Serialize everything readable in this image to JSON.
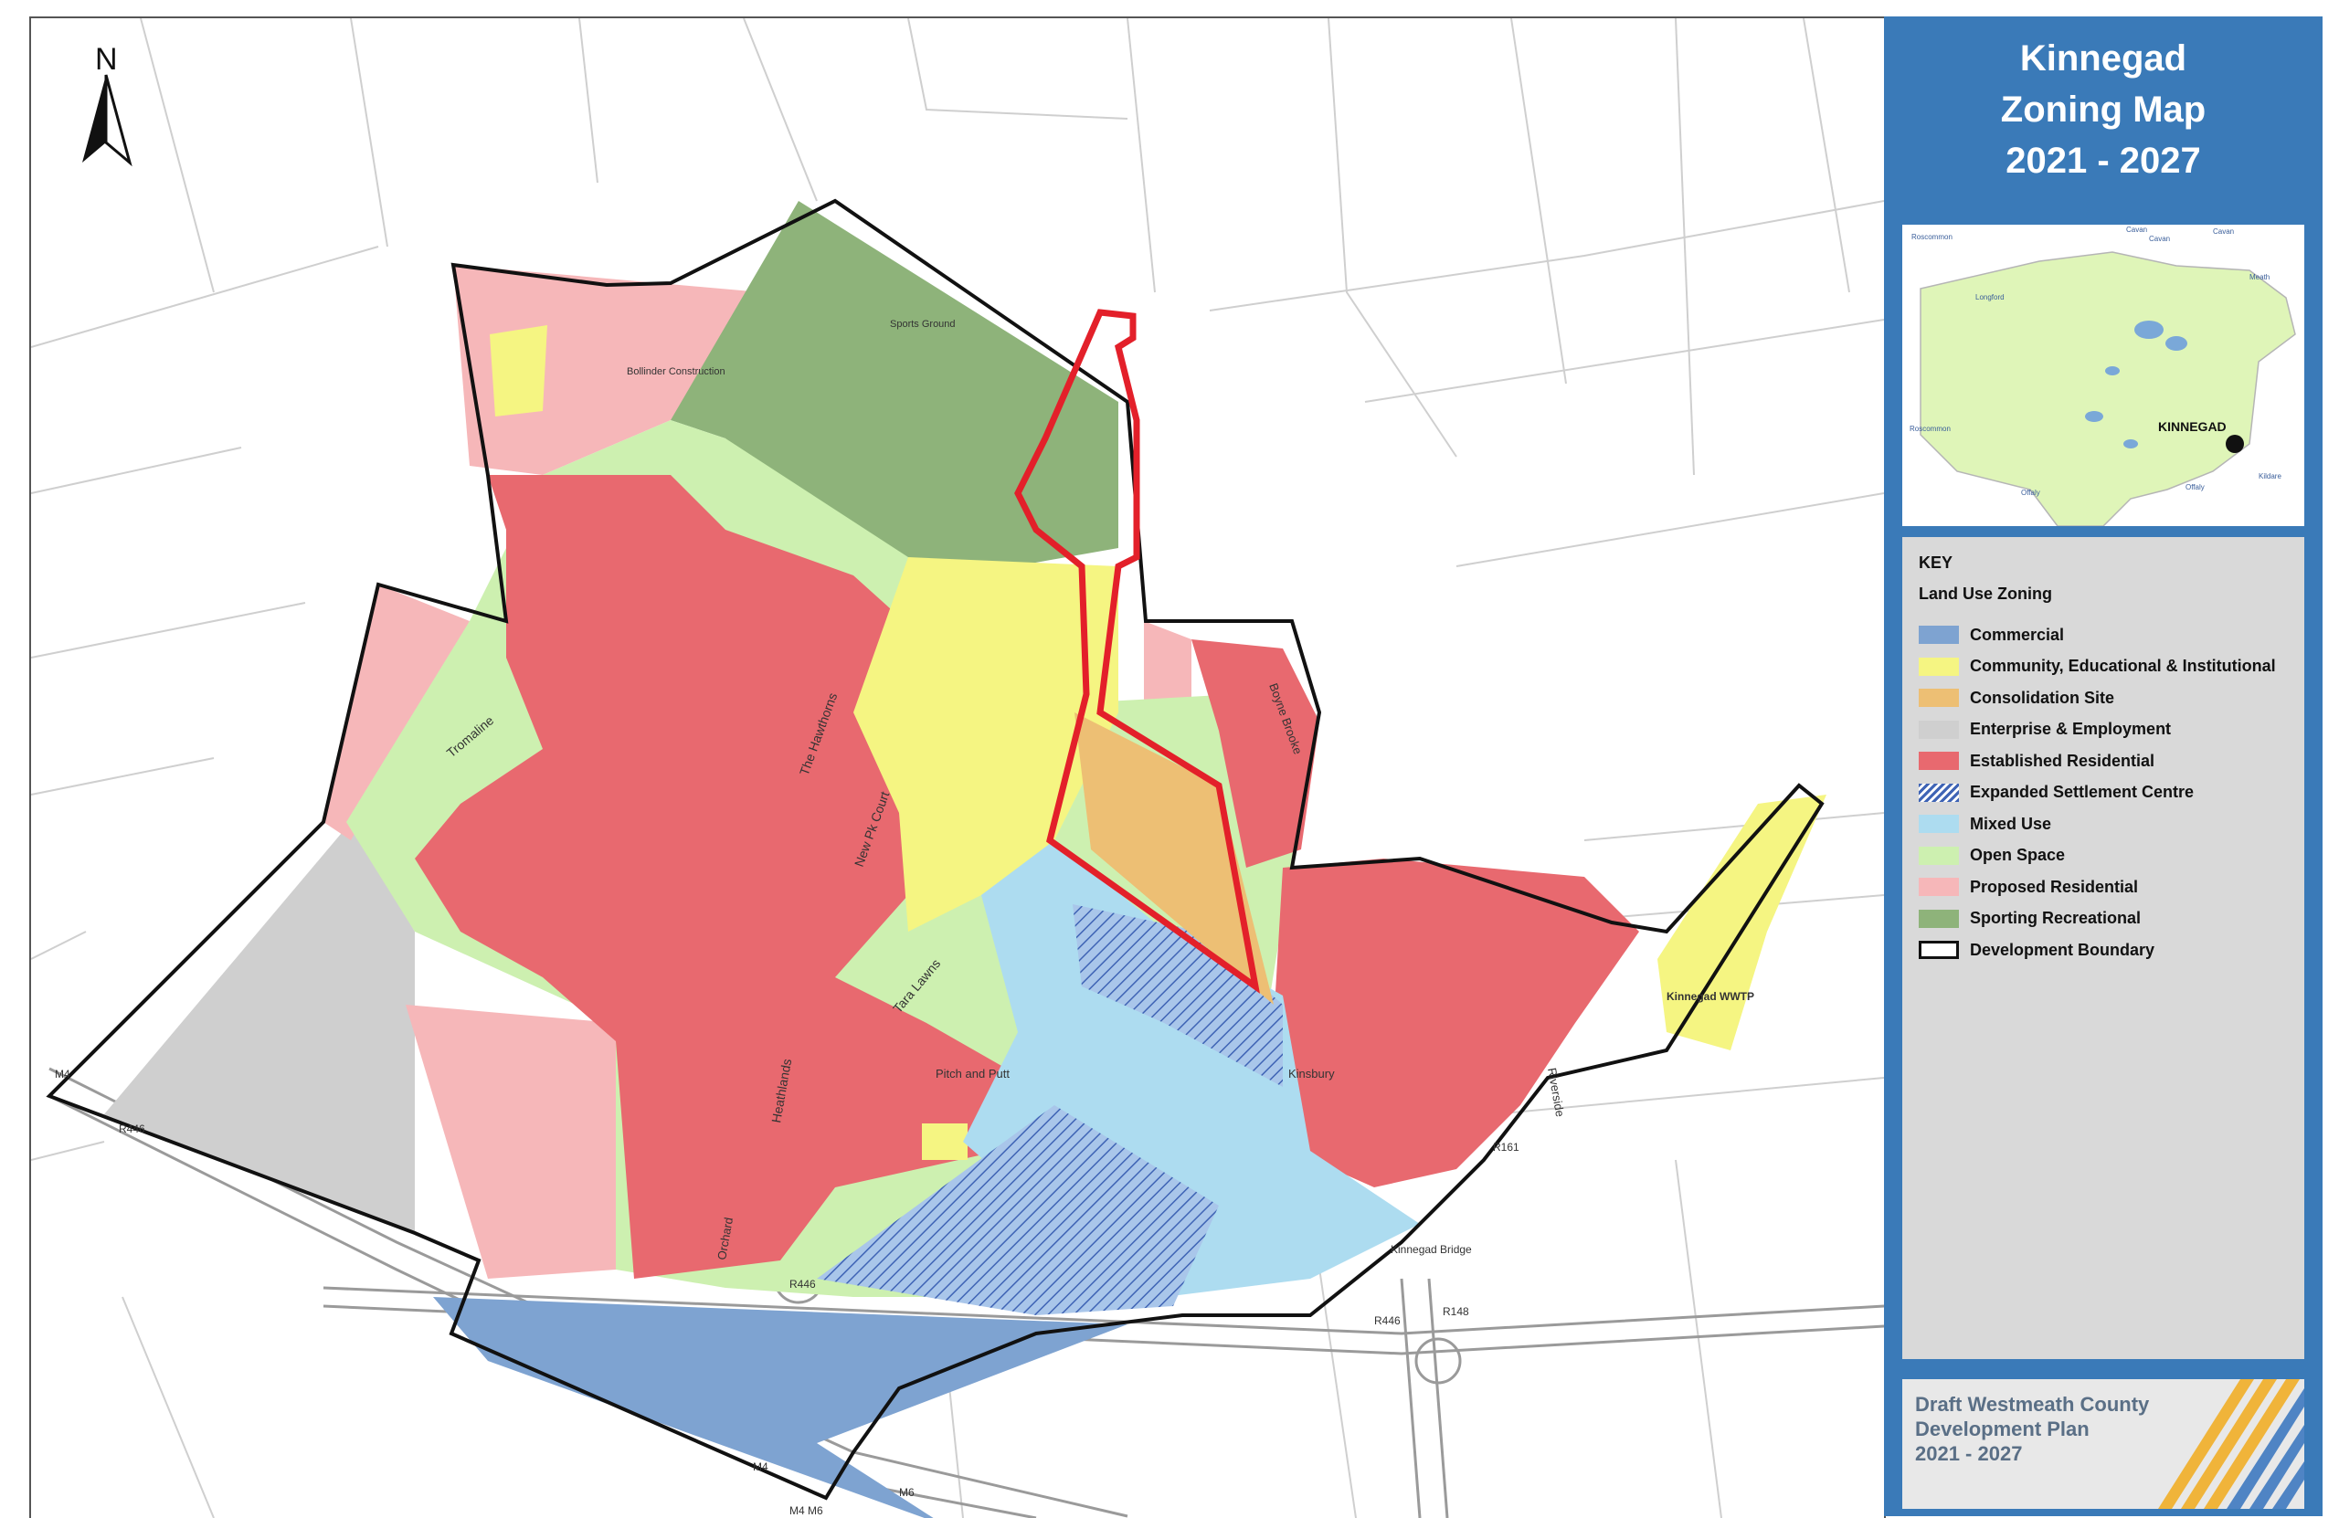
{
  "map": {
    "title_lines": [
      "Kinnegad",
      "Zoning Map",
      "2021 - 2027"
    ],
    "north_label": "N",
    "place_labels": {
      "sports_ground": "Sports Ground",
      "bollinder": "Bollinder Construction",
      "the_hawthorns": "The Hawthorns",
      "tromaline": "Tromaline",
      "new_park_court": "New Pk Court",
      "tara_lawns": "Tara Lawns",
      "heathlands": "Heathlands",
      "orchard": "Orchard",
      "pitch_and_putt": "Pitch and Putt",
      "boyne_brooke": "Boyne Brooke",
      "kinsbury": "Kinsbury",
      "riverside": "Riverside",
      "kinnegad_wwtp": "Kinnegad WWTP",
      "kinnegad_bridge": "Kinnegad Bridge",
      "r446_west": "R446",
      "r446_mid": "R446",
      "r446_east": "R446",
      "r148": "R148",
      "r161": "R161",
      "m4_west": "M4",
      "m4_south": "M4",
      "m6": "M6",
      "m4_m6": "M4 M6"
    }
  },
  "inset": {
    "town_label": "KINNEGAD",
    "county_labels": {
      "roscommon": "Roscommon",
      "cavan": "Cavan",
      "cavan2": "Cavan",
      "cavan3": "Cavan",
      "longford": "Longford",
      "meath": "Meath",
      "roscommon2": "Roscommon",
      "offaly": "Offaly",
      "offaly2": "Offaly",
      "kildare": "Kildare"
    }
  },
  "key": {
    "heading": "KEY",
    "subheading": "Land Use Zoning",
    "items": [
      {
        "label": "Commercial",
        "color": "#7ea3d1",
        "pattern": "solid"
      },
      {
        "label": "Community, Educational & Institutional",
        "color": "#f5f582",
        "pattern": "solid"
      },
      {
        "label": "Consolidation Site",
        "color": "#edbf74",
        "pattern": "solid"
      },
      {
        "label": "Enterprise & Employment",
        "color": "#cfcfcf",
        "pattern": "solid"
      },
      {
        "label": "Established Residential",
        "color": "#e8696f",
        "pattern": "solid"
      },
      {
        "label": "Expanded Settlement Centre",
        "color": "#5b7fc4",
        "pattern": "hatched"
      },
      {
        "label": "Mixed Use",
        "color": "#addcf0",
        "pattern": "solid"
      },
      {
        "label": "Open Space",
        "color": "#cdf0b0",
        "pattern": "solid"
      },
      {
        "label": "Proposed Residential",
        "color": "#f6b7b9",
        "pattern": "solid"
      },
      {
        "label": "Sporting Recreational",
        "color": "#8eb37a",
        "pattern": "solid"
      },
      {
        "label": "Development Boundary",
        "color": "#111111",
        "pattern": "outline"
      }
    ]
  },
  "brand": {
    "lines": [
      "Draft Westmeath County",
      "Development Plan",
      "2021 - 2027"
    ]
  },
  "colors": {
    "panel_blue": "#3a7ab8",
    "highlight_red": "#e3202a"
  }
}
